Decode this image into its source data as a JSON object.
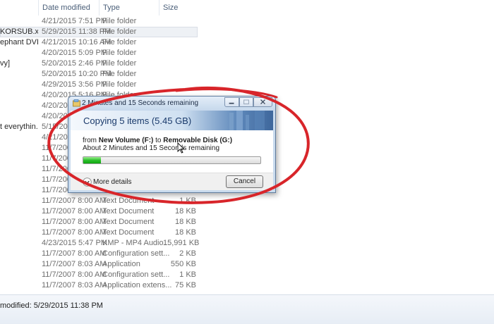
{
  "explorer": {
    "columns": {
      "date": "Date modified",
      "type": "Type",
      "size": "Size"
    },
    "rows": [
      {
        "name": "",
        "date": "4/21/2015 7:51 PM",
        "type": "File folder",
        "size": ""
      },
      {
        "name": "KORSUB.x2...",
        "date": "5/29/2015 11:38 PM",
        "type": "File folder",
        "size": "",
        "selected": true
      },
      {
        "name": "ephant DVD...",
        "date": "4/21/2015 10:16 AM",
        "type": "File folder",
        "size": ""
      },
      {
        "name": "",
        "date": "4/20/2015 5:09 PM",
        "type": "File folder",
        "size": ""
      },
      {
        "name": "vy]",
        "date": "5/20/2015 2:46 PM",
        "type": "File folder",
        "size": ""
      },
      {
        "name": "",
        "date": "5/20/2015 10:20 PM",
        "type": "File folder",
        "size": ""
      },
      {
        "name": "",
        "date": "4/29/2015 3:56 PM",
        "type": "File folder",
        "size": ""
      },
      {
        "name": "",
        "date": "4/20/2015 5:16 PM",
        "type": "File folder",
        "size": ""
      },
      {
        "name": "",
        "date": "4/20/2015",
        "type": "",
        "size": ""
      },
      {
        "name": "",
        "date": "4/20/2015",
        "type": "",
        "size": ""
      },
      {
        "name": "t everythin...",
        "date": "5/15/2015",
        "type": "",
        "size": ""
      },
      {
        "name": "",
        "date": "4/21/2015",
        "type": "",
        "size": ""
      },
      {
        "name": "",
        "date": "11/7/2007",
        "type": "",
        "size": ""
      },
      {
        "name": "",
        "date": "11/7/2007",
        "type": "",
        "size": ""
      },
      {
        "name": "",
        "date": "11/7/2007",
        "type": "",
        "size": ""
      },
      {
        "name": "",
        "date": "11/7/2007",
        "type": "",
        "size": ""
      },
      {
        "name": "",
        "date": "11/7/2007",
        "type": "",
        "size": ""
      },
      {
        "name": "",
        "date": "11/7/2007 8:00 AM",
        "type": "Text Document",
        "size": "1 KB"
      },
      {
        "name": "",
        "date": "11/7/2007 8:00 AM",
        "type": "Text Document",
        "size": "18 KB"
      },
      {
        "name": "",
        "date": "11/7/2007 8:00 AM",
        "type": "Text Document",
        "size": "18 KB"
      },
      {
        "name": "",
        "date": "11/7/2007 8:00 AM",
        "type": "Text Document",
        "size": "18 KB"
      },
      {
        "name": "",
        "date": "4/23/2015 5:47 PM",
        "type": "KMP - MP4 Audio...",
        "size": "15,991 KB"
      },
      {
        "name": "",
        "date": "11/7/2007 8:00 AM",
        "type": "Configuration sett...",
        "size": "2 KB"
      },
      {
        "name": "",
        "date": "11/7/2007 8:03 AM",
        "type": "Application",
        "size": "550 KB"
      },
      {
        "name": "",
        "date": "11/7/2007 8:00 AM",
        "type": "Configuration sett...",
        "size": "1 KB"
      },
      {
        "name": "",
        "date": "11/7/2007 8:03 AM",
        "type": "Application extens...",
        "size": "75 KB"
      }
    ],
    "status": "modified: 5/29/2015 11:38 PM"
  },
  "dialog": {
    "title": "2 Minutes and 15 Seconds remaining",
    "heading": "Copying 5 items (5.45 GB)",
    "from_prefix": "from ",
    "source": "New Volume (F:)",
    "to_word": " to ",
    "destination": "Removable Disk (G:)",
    "remaining": "About 2 Minutes and 15 Seconds remaining",
    "progress_fraction": 0.1,
    "more_details": "More details",
    "cancel": "Cancel"
  },
  "colors": {
    "annotation": "#d8252a",
    "progress": "#2cc02c",
    "heading": "#1a3a6b"
  }
}
